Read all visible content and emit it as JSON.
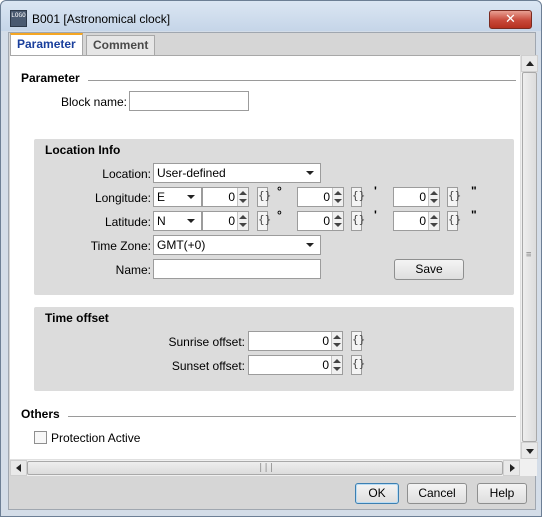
{
  "window": {
    "title": "B001 [Astronomical clock]",
    "icon_text": "LOGO",
    "close_label": "✕"
  },
  "tabs": [
    {
      "label": "Parameter",
      "active": true
    },
    {
      "label": "Comment",
      "active": false
    }
  ],
  "parameter": {
    "heading": "Parameter",
    "block_name_label": "Block name:",
    "block_name_value": ""
  },
  "location_info": {
    "heading": "Location Info",
    "location_label": "Location:",
    "location_value": "User-defined",
    "longitude_label": "Longitude:",
    "longitude_dir": "E",
    "latitude_label": "Latitude:",
    "latitude_dir": "N",
    "degree_symbol": "°",
    "minute_symbol": "'",
    "second_symbol": "\"",
    "longitude_values": {
      "deg": "0",
      "min": "0",
      "sec": "0"
    },
    "latitude_values": {
      "deg": "0",
      "min": "0",
      "sec": "0"
    },
    "bracket_glyph": "{}",
    "timezone_label": "Time Zone:",
    "timezone_value": "GMT(+0)",
    "name_label": "Name:",
    "name_value": "",
    "save_label": "Save"
  },
  "time_offset": {
    "heading": "Time offset",
    "sunrise_label": "Sunrise offset:",
    "sunrise_value": "0",
    "sunset_label": "Sunset offset:",
    "sunset_value": "0"
  },
  "others": {
    "heading": "Others",
    "protection_label": "Protection Active",
    "protection_checked": false
  },
  "scrollbar": {
    "grip_glyph_v": "≡",
    "grip_glyph_h": "|||"
  },
  "footer": {
    "ok_label": "OK",
    "cancel_label": "Cancel",
    "help_label": "Help"
  }
}
